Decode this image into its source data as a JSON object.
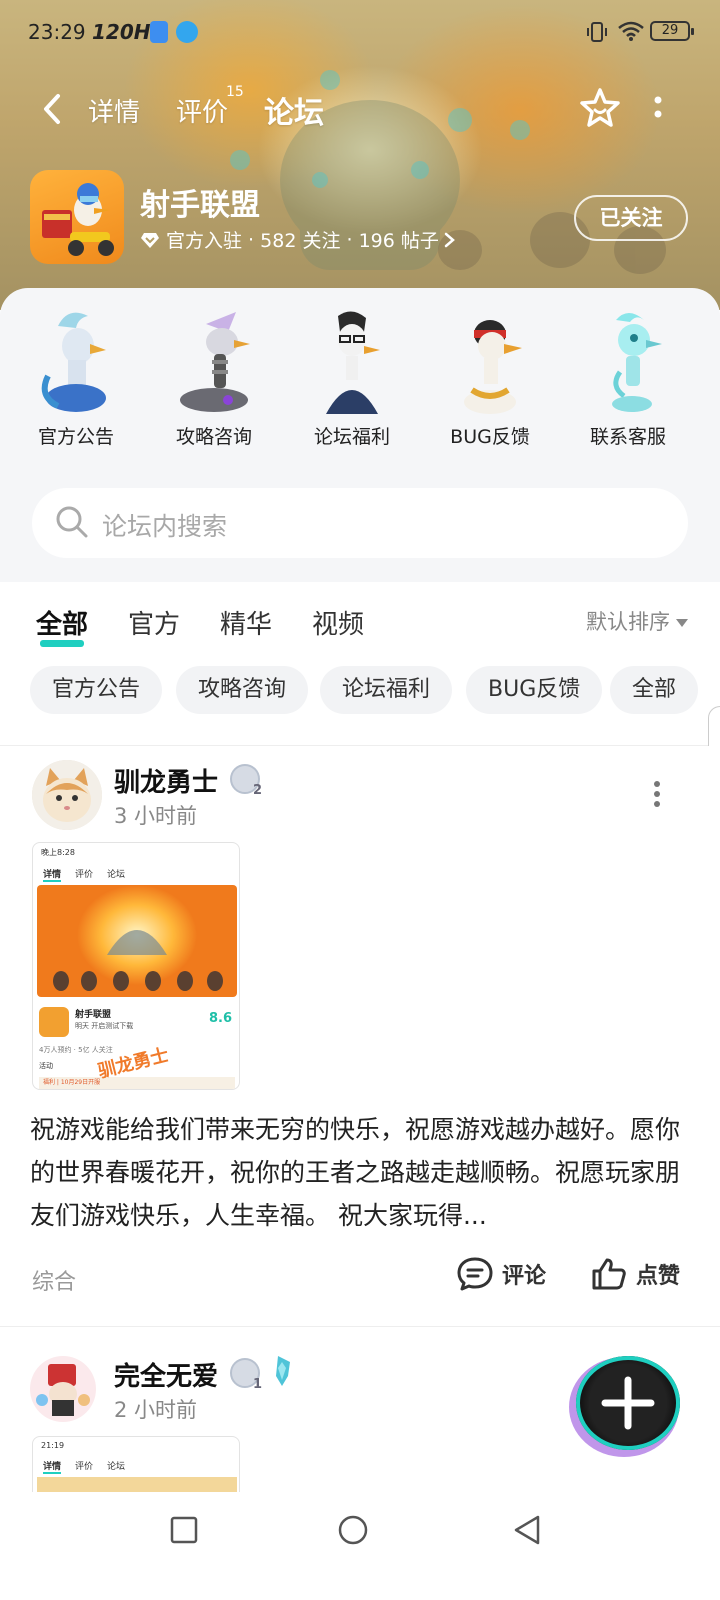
{
  "status_bar": {
    "time": "23:29",
    "refresh_rate": "120Hz",
    "battery": "29"
  },
  "nav": {
    "tabs": [
      {
        "label": "详情"
      },
      {
        "label": "评价",
        "badge": "15"
      },
      {
        "label": "论坛"
      }
    ],
    "active_tab": "论坛"
  },
  "app": {
    "title": "射手联盟",
    "official": "官方入驻",
    "followers": "582 关注",
    "posts": "196 帖子",
    "follow_label": "已关注"
  },
  "categories": [
    {
      "label": "官方公告",
      "icon": "blue-goose-icon"
    },
    {
      "label": "攻略咨询",
      "icon": "robot-goose-icon"
    },
    {
      "label": "论坛福利",
      "icon": "glasses-goose-icon"
    },
    {
      "label": "BUG反馈",
      "icon": "bandana-goose-icon"
    },
    {
      "label": "联系客服",
      "icon": "ghost-goose-icon"
    }
  ],
  "search": {
    "placeholder": "论坛内搜索"
  },
  "filter_tabs": [
    "全部",
    "官方",
    "精华",
    "视频"
  ],
  "active_filter": "全部",
  "sort_label": "默认排序",
  "chips": [
    "官方公告",
    "攻略咨询",
    "论坛福利",
    "BUG反馈",
    "全部"
  ],
  "posts": [
    {
      "author": "驯龙勇士",
      "level": "2",
      "time": "3 小时前",
      "text": "祝游戏能给我们带来无穷的快乐，祝愿游戏越办越好。愿你的世界春暖花开，祝你的王者之路越走越顺畅。祝愿玩家朋友们游戏快乐，人生幸福。 祝大家玩得...",
      "category": "综合",
      "comment_label": "评论",
      "like_label": "点赞",
      "thumb": {
        "time": "晚上8:28",
        "tabs": [
          "详情",
          "评价",
          "论坛"
        ],
        "app_name": "射手联盟",
        "subtitle": "明天 开启测试下载",
        "score": "8.6",
        "stats": "4万人预约 · 5亿 人关注",
        "activity": "活动",
        "watermark": "驯龙勇士",
        "banner": "福利 | 10月29日开服"
      }
    },
    {
      "author": "完全无爱",
      "level": "1",
      "time": "2 小时前",
      "thumb": {
        "time": "21:19",
        "tabs": [
          "详情",
          "评价",
          "论坛"
        ]
      }
    }
  ],
  "colors": {
    "accent": "#1fcfc0",
    "text": "#222222",
    "muted": "#888888"
  }
}
